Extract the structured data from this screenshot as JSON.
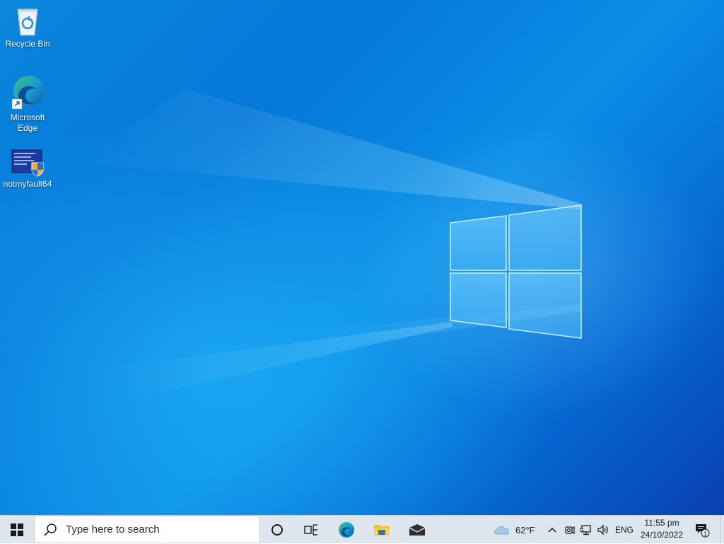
{
  "desktop": {
    "icons": [
      {
        "label": "Recycle Bin",
        "icon": "recycle-bin-icon"
      },
      {
        "label": "Microsoft Edge",
        "icon": "edge-icon"
      },
      {
        "label": "notmyfault64",
        "icon": "notmyfault-app-icon"
      }
    ]
  },
  "taskbar": {
    "start_icon": "windows-start-icon",
    "search_placeholder": "Type here to search",
    "pinned": [
      {
        "name": "cortana",
        "icon": "cortana-circle-icon"
      },
      {
        "name": "task-view",
        "icon": "task-view-icon"
      },
      {
        "name": "edge",
        "icon": "edge-icon"
      },
      {
        "name": "file-explorer",
        "icon": "folder-icon"
      },
      {
        "name": "mail",
        "icon": "mail-icon"
      }
    ],
    "tray": {
      "weather_temp": "62°F",
      "weather_icon": "cloud-icon",
      "language": "ENG",
      "time": "11:55 pm",
      "date": "24/10/2022",
      "notification_count": "1"
    }
  },
  "colors": {
    "taskbar_bg": "#dde6ef",
    "desktop_blue": "#0678d8",
    "edge_blue": "#0c59a4",
    "edge_green": "#3fc26b",
    "folder_yellow": "#f2c12e"
  }
}
